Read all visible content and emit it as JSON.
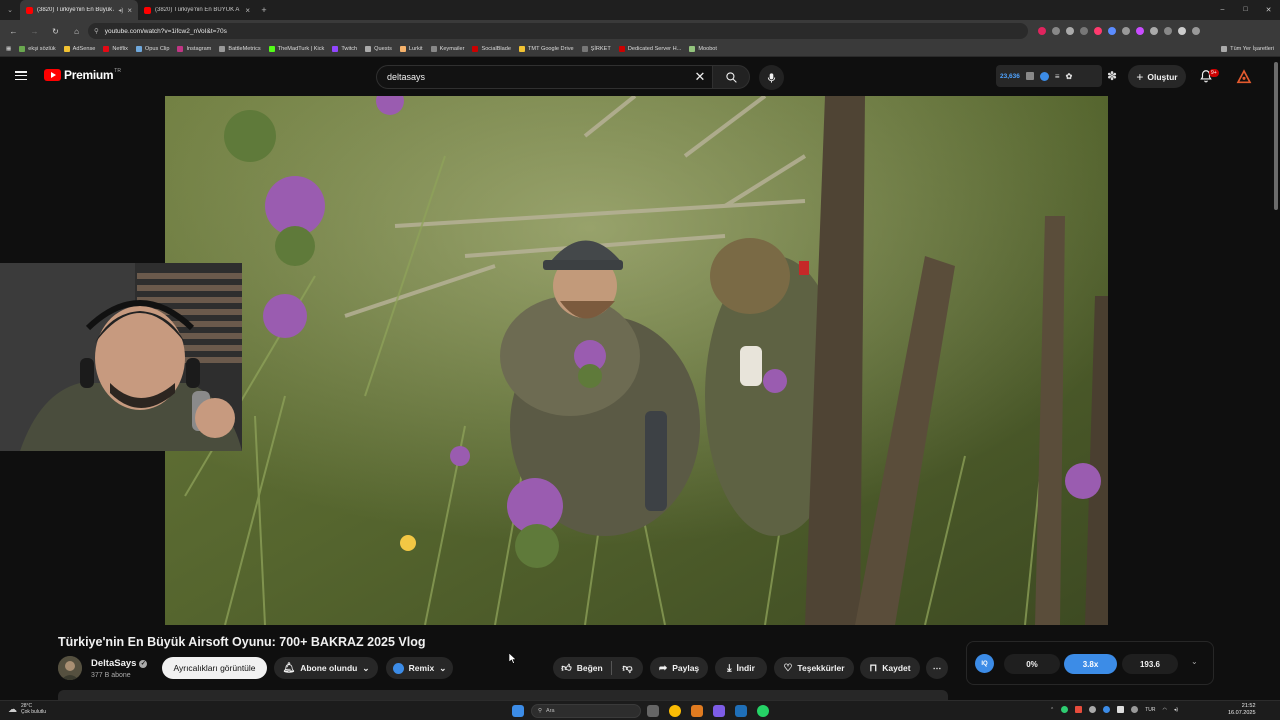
{
  "browser": {
    "tabs": [
      {
        "title": "(3820) Türkiye'nin En Büyük A",
        "active": true
      },
      {
        "title": "(3820) Türkiye'nin En BÜYÜK A",
        "active": false
      }
    ],
    "url": "youtube.com/watch?v=1ifcw2_nVoI&t=70s",
    "bookmarks": [
      "ekşi sözlük",
      "AdSense",
      "Netflix",
      "Opus Clip",
      "Instagram",
      "BattleMetrics",
      "TheMadTurk | Kick",
      "Twitch",
      "Quests",
      "Lurkit",
      "Keymailer",
      "SocialBlade",
      "TMT Google Drive",
      "ŞİRKET",
      "Dedicated Server H...",
      "Moobot"
    ],
    "all_bookmarks": "Tüm Yer İşaretleri"
  },
  "youtube": {
    "logo_text": "Premium",
    "region": "TR",
    "search_value": "deltasays",
    "header_count": "23,636",
    "create_label": "Oluştur",
    "notif_badge": "9+"
  },
  "video": {
    "title": "Türkiye'nin En Büyük Airsoft Oyunu: 700+ BAKRAZ 2025 Vlog",
    "channel": "DeltaSays",
    "subscribers": "377 B abone",
    "highlights_label": "Ayrıcalıkları görüntüle",
    "subscribed_label": "Abone olundu",
    "remix_label": "Remix",
    "like_label": "Beğen",
    "share_label": "Paylaş",
    "download_label": "İndir",
    "thanks_label": "Teşekkürler",
    "save_label": "Kaydet"
  },
  "stats": {
    "values": [
      "0%",
      "3.8x",
      "193.6"
    ]
  },
  "taskbar": {
    "temperature": "28°C",
    "weather": "Çok bulutlu",
    "search_placeholder": "Ara",
    "language": "TUR",
    "time": "21:52",
    "date": "16.07.2025"
  },
  "colors": {
    "accent_red": "#ff0000",
    "stat_blue": "#3c8ce7",
    "background": "#0f0f0f"
  }
}
